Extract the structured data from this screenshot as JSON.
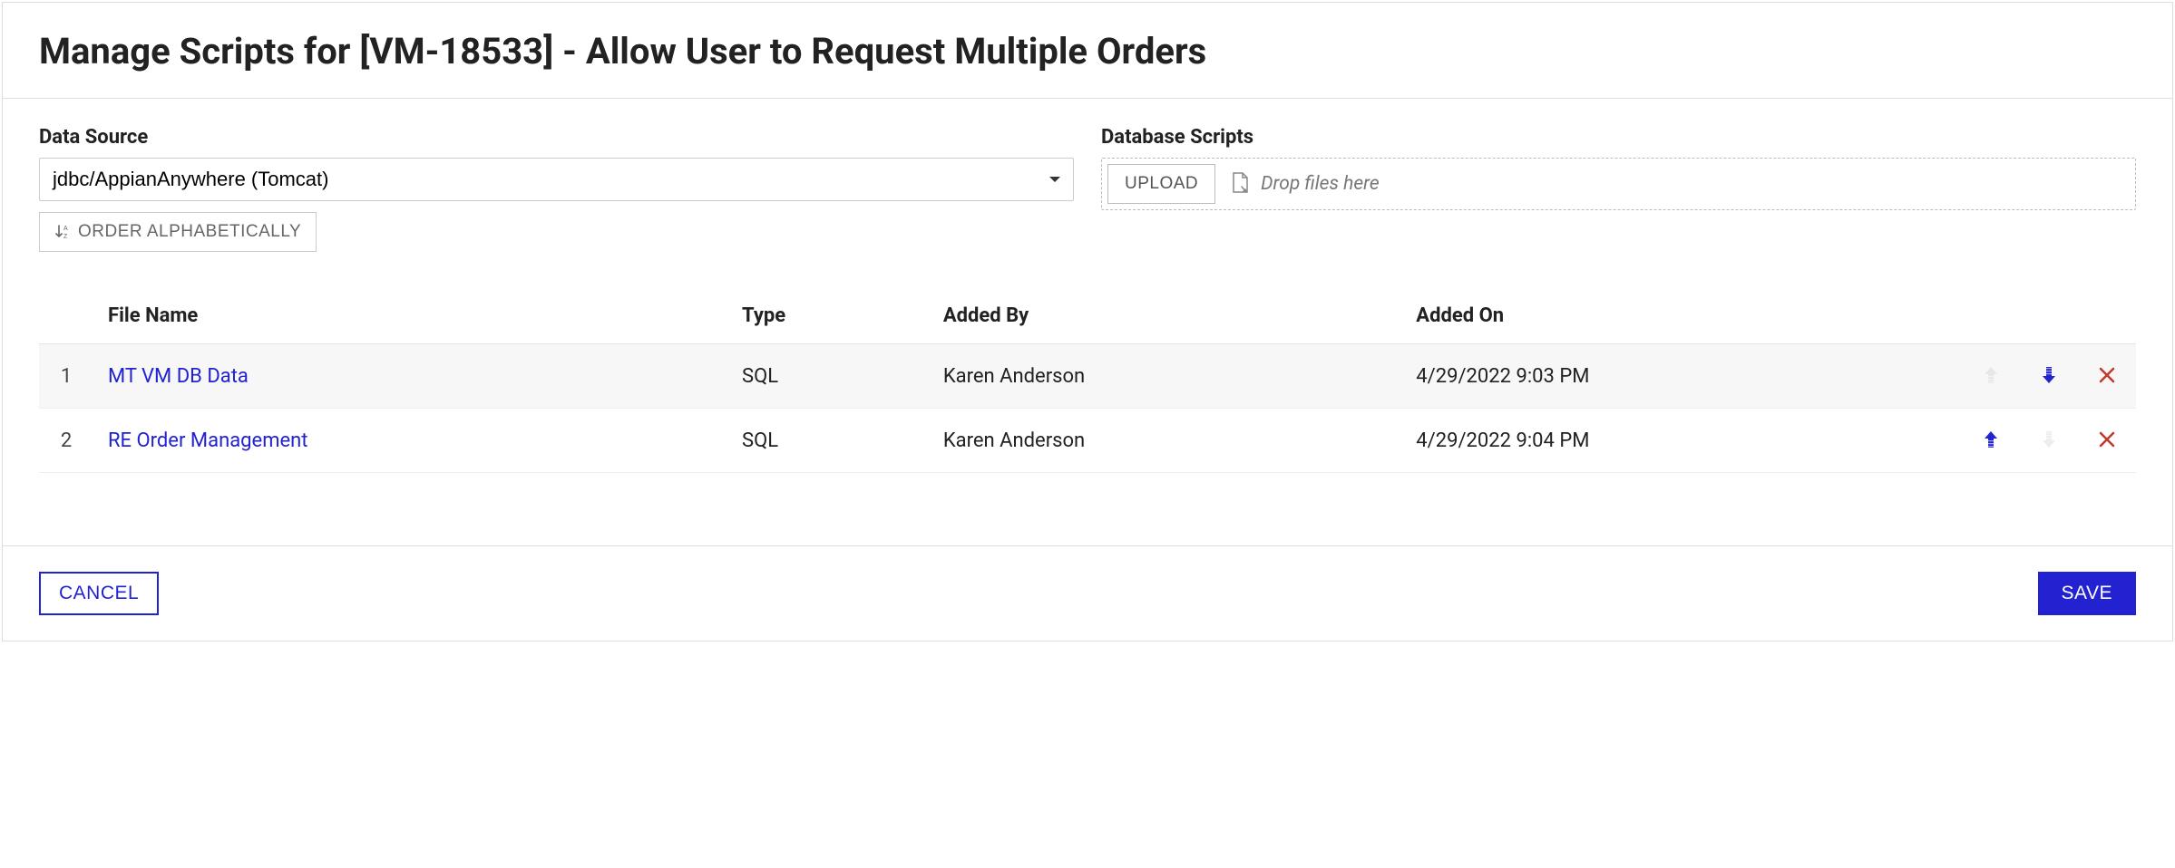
{
  "header": {
    "title": "Manage Scripts for [VM-18533] - Allow User to Request Multiple Orders"
  },
  "dataSource": {
    "label": "Data Source",
    "value": "jdbc/AppianAnywhere (Tomcat)",
    "orderButton": "ORDER ALPHABETICALLY"
  },
  "databaseScripts": {
    "label": "Database Scripts",
    "uploadButton": "UPLOAD",
    "dropPlaceholder": "Drop files here"
  },
  "table": {
    "columns": {
      "fileName": "File Name",
      "type": "Type",
      "addedBy": "Added By",
      "addedOn": "Added On"
    },
    "rows": [
      {
        "index": "1",
        "fileName": "MT VM DB Data",
        "type": "SQL",
        "addedBy": "Karen Anderson",
        "addedOn": "4/29/2022 9:03 PM",
        "upEnabled": false,
        "downEnabled": true
      },
      {
        "index": "2",
        "fileName": "RE Order Management",
        "type": "SQL",
        "addedBy": "Karen Anderson",
        "addedOn": "4/29/2022 9:04 PM",
        "upEnabled": true,
        "downEnabled": false
      }
    ]
  },
  "footer": {
    "cancel": "CANCEL",
    "save": "SAVE"
  },
  "colors": {
    "primary": "#2322d0",
    "danger": "#c0392b",
    "muted": "#cccccc"
  }
}
